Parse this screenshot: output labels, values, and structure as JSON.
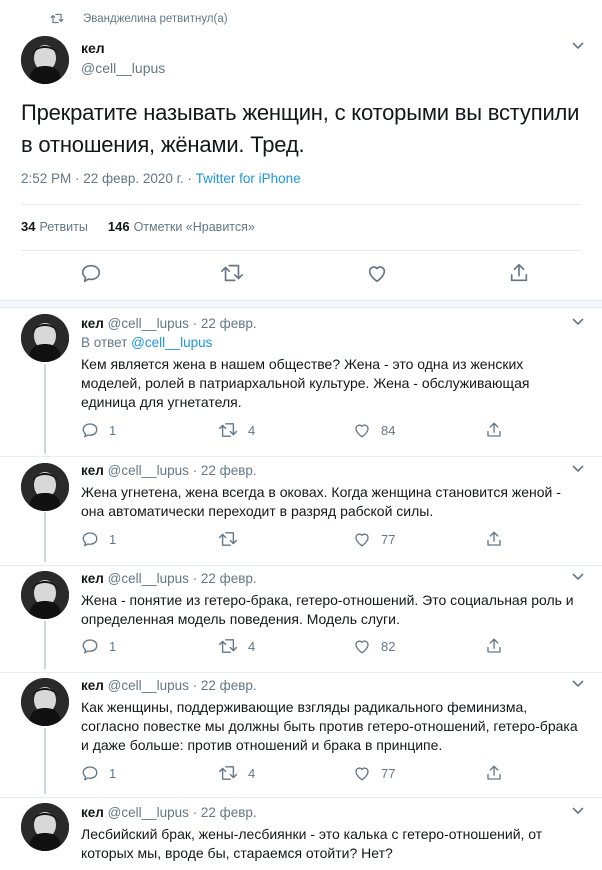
{
  "retweet_banner": {
    "text": "Эванджелина ретвитнул(а)",
    "icon": "retweet-icon"
  },
  "main_tweet": {
    "name": "кел",
    "handle": "@cell__lupus",
    "text": "Прекратите называть женщин, с которыми вы вступили в отношения, жёнами. Тред.",
    "time": "2:52 PM · 22 февр. 2020 г. · ",
    "source": "Twitter for iPhone",
    "retweets_count": "34",
    "retweets_label": "Ретвиты",
    "likes_count": "146",
    "likes_label": "Отметки «Нравится»"
  },
  "replies": [
    {
      "name": "кел",
      "handle": "@cell__lupus · 22 февр.",
      "in_reply_prefix": "В ответ ",
      "in_reply_handle": "@cell__lupus",
      "text": "Кем является жена в нашем обществе? Жена - это одна из женских моделей, ролей в патриархальной культуре. Жена - обслуживающая единица для угнетателя.",
      "replies": "1",
      "retweets": "4",
      "likes": "84"
    },
    {
      "name": "кел",
      "handle": "@cell__lupus · 22 февр.",
      "text": "Жена угнетена, жена всегда в оковах. Когда женщина становится женой - она автоматически переходит в разряд рабской силы.",
      "replies": "1",
      "retweets": "",
      "likes": "77"
    },
    {
      "name": "кел",
      "handle": "@cell__lupus · 22 февр.",
      "text": "Жена - понятие из гетеро-брака, гетеро-отношений. Это социальная роль и определенная модель поведения. Модель слуги.",
      "replies": "1",
      "retweets": "4",
      "likes": "82"
    },
    {
      "name": "кел",
      "handle": "@cell__lupus · 22 февр.",
      "text": "Как женщины, поддерживающие взгляды радикального феминизма, согласно повестке мы должны быть против гетеро-отношений, гетеро-брака и даже больше: против отношений и брака в принципе.",
      "replies": "1",
      "retweets": "4",
      "likes": "77"
    },
    {
      "name": "кел",
      "handle": "@cell__lupus · 22 февр.",
      "text": "Лесбийский брак, жены-лесбиянки - это калька с гетеро-отношений, от которых мы, вроде бы, стараемся отойти? Нет?"
    }
  ],
  "colors": {
    "link": "#1b95e0",
    "muted": "#657786",
    "text": "#14171a",
    "divider": "#e6ecf0"
  }
}
